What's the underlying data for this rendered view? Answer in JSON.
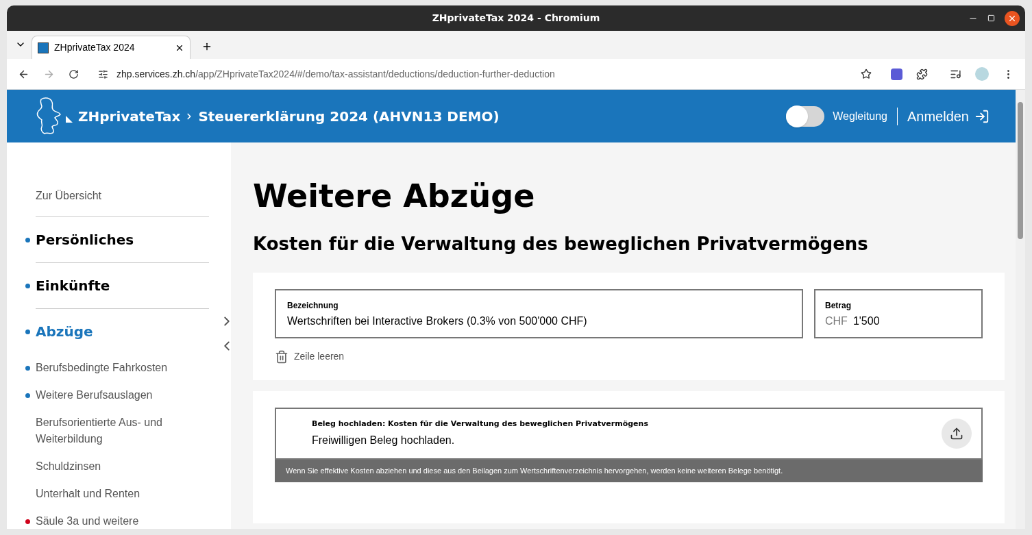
{
  "window": {
    "title": "ZHprivateTax 2024 - Chromium"
  },
  "tabs": [
    {
      "label": "ZHprivateTax 2024",
      "selected": true
    }
  ],
  "address_bar": {
    "host": "zhp.services.zh.ch",
    "path": "/app/ZHprivateTax2024/#/demo/tax-assistant/deductions/deduction-further-deduction"
  },
  "header": {
    "brand": "ZHprivateTax",
    "title": "Steuererklärung 2024 (AHVN13 DEMO)",
    "guide_toggle": {
      "label": "Wegleitung",
      "on": false
    },
    "login": "Anmelden"
  },
  "sidebar": {
    "items": [
      {
        "kind": "link",
        "label": "Zur Übersicht",
        "selected": false
      },
      {
        "kind": "section",
        "label": "Persönliches",
        "selected": false,
        "color": "#1a75bb"
      },
      {
        "kind": "section",
        "label": "Einkünfte",
        "selected": false,
        "color": "#1a75bb"
      },
      {
        "kind": "section",
        "label": "Abzüge",
        "selected": true,
        "color": "#1a75bb"
      },
      {
        "kind": "sub",
        "label": "Berufsbedingte Fahrkosten",
        "selected": false,
        "color": "#1a75bb"
      },
      {
        "kind": "sub",
        "label": "Weitere Berufsauslagen",
        "selected": false,
        "color": "#1a75bb"
      },
      {
        "kind": "sub",
        "label": "Berufsorientierte Aus- und Weiterbildung",
        "selected": false
      },
      {
        "kind": "sub",
        "label": "Schuldzinsen",
        "selected": false
      },
      {
        "kind": "sub",
        "label": "Unterhalt und Renten",
        "selected": false
      },
      {
        "kind": "sub",
        "label": "Säule 3a und weitere",
        "selected": false,
        "color": "#d0021b"
      }
    ]
  },
  "page": {
    "title": "Weitere Abzüge",
    "section_title": "Kosten für die Verwaltung des beweglichen Privatvermögens",
    "row": {
      "description": {
        "label": "Bezeichnung",
        "value": "Wertschriften bei Interactive Brokers (0.3% von 500'000 CHF)"
      },
      "amount": {
        "label": "Betrag",
        "currency": "CHF",
        "value": "1'500"
      },
      "clear": "Zeile leeren"
    },
    "upload": {
      "title": "Beleg hochladen: Kosten für die Verwaltung des beweglichen Privatvermögens",
      "text": "Freiwilligen Beleg hochladen.",
      "note": "Wenn Sie effektive Kosten abziehen und diese aus den Beilagen zum Wertschriftenverzeichnis hervorgehen, werden keine weiteren Belege benötigt."
    }
  }
}
